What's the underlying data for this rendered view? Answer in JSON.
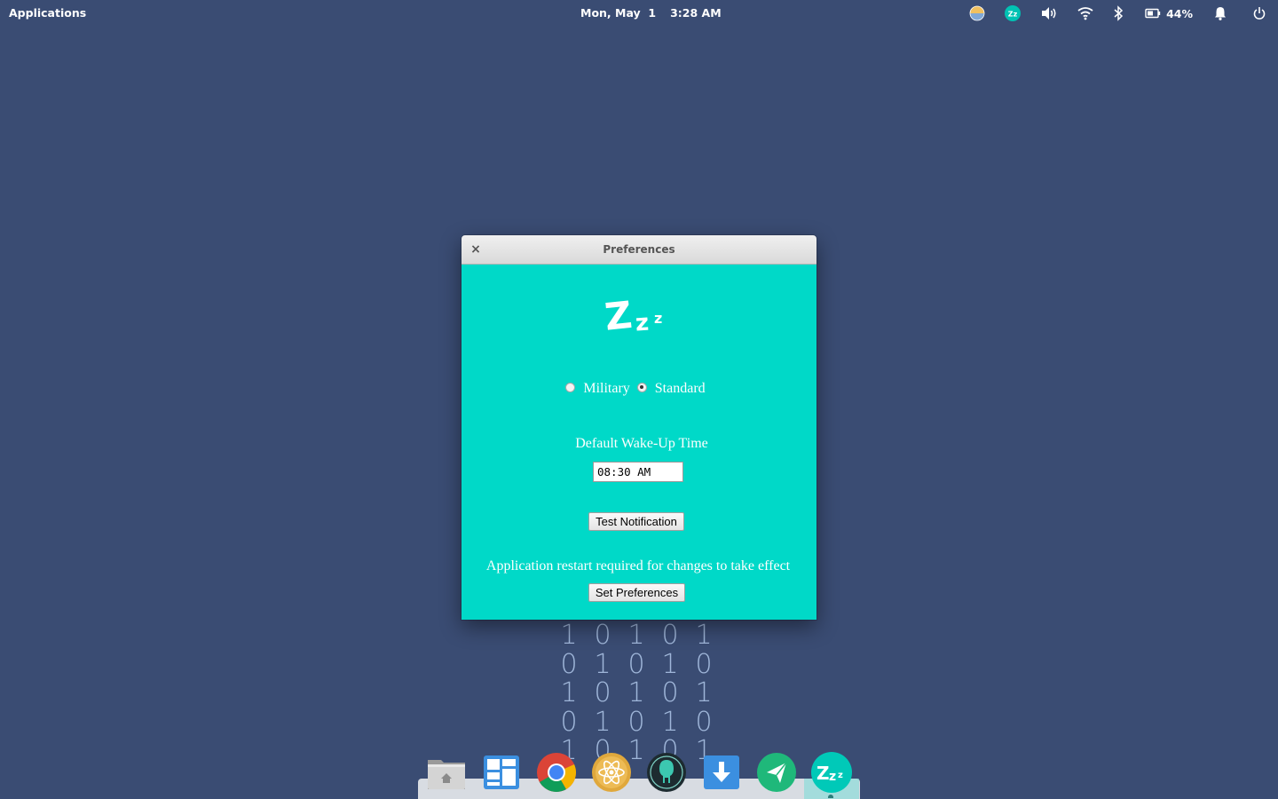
{
  "top_panel": {
    "applications_label": "Applications",
    "date": "Mon, May  1",
    "time": "3:28 AM",
    "indicators": [
      "night-light-icon",
      "zzz-indicator-icon",
      "volume-icon",
      "wifi-icon",
      "bluetooth-icon",
      "battery-icon",
      "notifications-icon",
      "power-icon"
    ],
    "battery_percent": "44%"
  },
  "desktop": {
    "binary_rows": [
      [
        "1",
        "0",
        "1",
        "0",
        "1"
      ],
      [
        "0",
        "1",
        "0",
        "1",
        "0"
      ],
      [
        "1",
        "0",
        "1",
        "0",
        "1"
      ],
      [
        "0",
        "1",
        "0",
        "1",
        "0"
      ],
      [
        "1",
        "0",
        "1",
        "0",
        "1"
      ]
    ]
  },
  "dialog": {
    "title": "Preferences",
    "close_label": "×",
    "logo_text": "Zzz",
    "time_format": {
      "options": [
        "Military",
        "Standard"
      ],
      "selected": "Standard"
    },
    "wake_up_label": "Default Wake-Up Time",
    "wake_up_value": "08:30 AM",
    "test_button": "Test Notification",
    "restart_notice": "Application restart required for changes to take effect",
    "set_button": "Set Preferences"
  },
  "dock": {
    "items": [
      "home-folder",
      "multitasking-view",
      "chrome",
      "atom",
      "gitkraken",
      "downloader",
      "send",
      "zzz"
    ],
    "active": "zzz"
  },
  "colors": {
    "desktop_bg": "#3a4c73",
    "dialog_bg": "#00d9c8",
    "binary_text": "#9fb6d9"
  }
}
